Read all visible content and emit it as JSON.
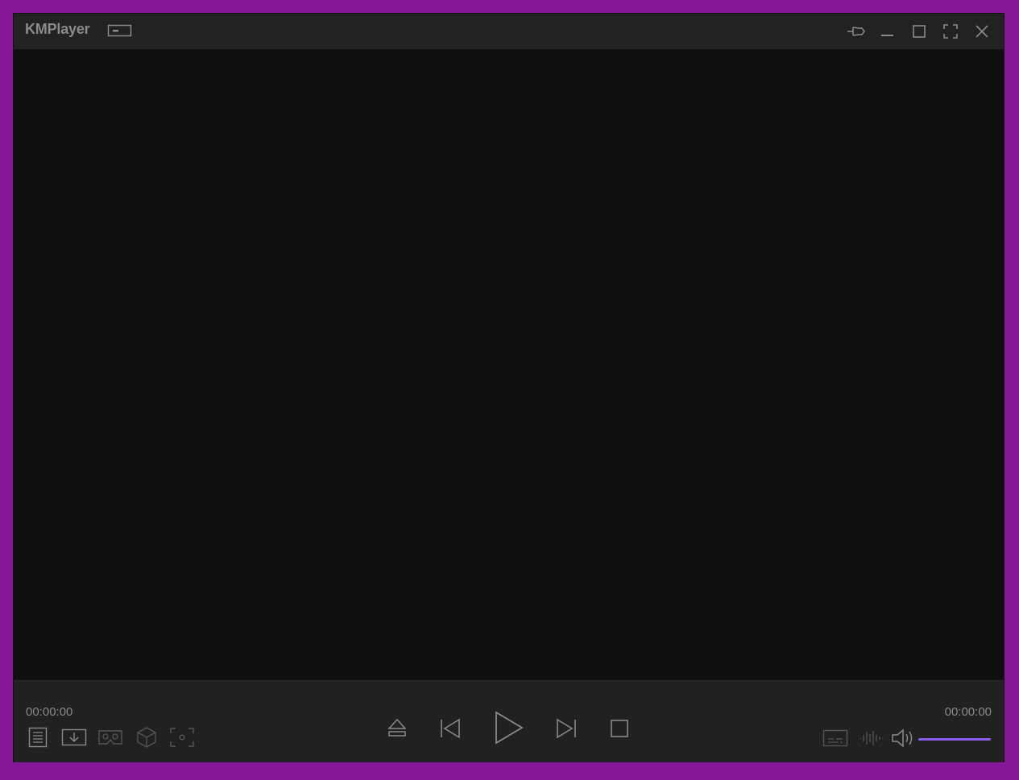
{
  "app": {
    "title": "KMPlayer",
    "accent_color": "#8a5cf0",
    "frame_color": "#851899"
  },
  "titlebar": {
    "icons": [
      "mini-mode-icon",
      "pin-icon",
      "minimize-icon",
      "maximize-icon",
      "fullscreen-icon",
      "close-icon"
    ]
  },
  "controls": {
    "current_time": "00:00:00",
    "total_time": "00:00:00",
    "left_icons": [
      "playlist-icon",
      "download-icon",
      "vr-headset-icon",
      "3d-cube-icon",
      "capture-icon"
    ],
    "center_icons": [
      "eject-icon",
      "previous-icon",
      "play-icon",
      "next-icon",
      "stop-icon"
    ],
    "right_icons": [
      "subtitle-icon",
      "equalizer-icon",
      "volume-icon"
    ],
    "volume_level": 1.0
  }
}
